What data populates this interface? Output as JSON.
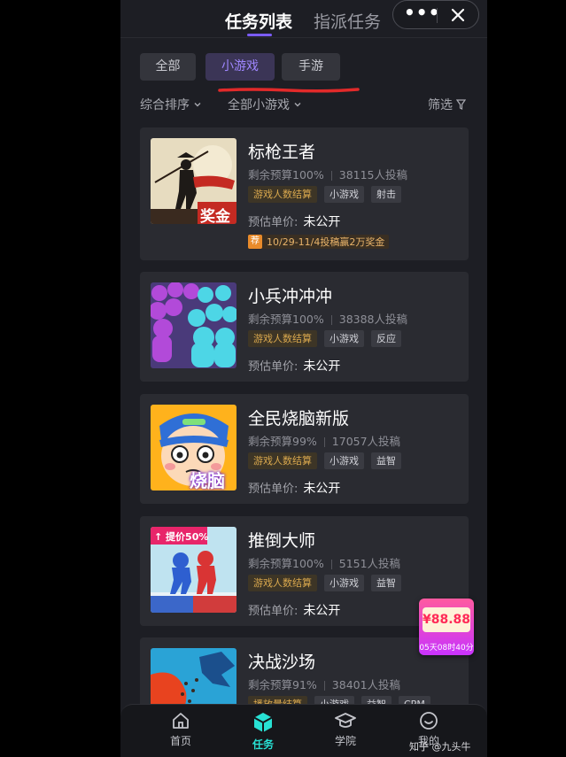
{
  "header": {
    "tab_active": "任务列表",
    "tab_inactive": "指派任务",
    "more_icon": "more-dots-icon",
    "close_icon": "close-icon"
  },
  "filters": {
    "chips": [
      "全部",
      "小游戏",
      "手游"
    ],
    "selected": "小游戏",
    "sort_label": "综合排序",
    "category_label": "全部小游戏",
    "filter_label": "筛选"
  },
  "tasks": [
    {
      "title": "标枪王者",
      "budget": "剩余预算100%",
      "submissions": "38115人投稿",
      "tags": [
        "游戏人数结算",
        "小游戏",
        "射击"
      ],
      "price_label": "预估单价:",
      "price_value": "未公开",
      "thumb_label": "奖金",
      "promo_badge": "荐",
      "promo_text": "10/29-11/4投稿赢2万奖金"
    },
    {
      "title": "小兵冲冲冲",
      "budget": "剩余预算100%",
      "submissions": "38388人投稿",
      "tags": [
        "游戏人数结算",
        "小游戏",
        "反应"
      ],
      "price_label": "预估单价:",
      "price_value": "未公开"
    },
    {
      "title": "全民烧脑新版",
      "budget": "剩余预算99%",
      "submissions": "17057人投稿",
      "tags": [
        "游戏人数结算",
        "小游戏",
        "益智"
      ],
      "price_label": "预估单价:",
      "price_value": "未公开",
      "thumb_label": "烧脑"
    },
    {
      "title": "推倒大师",
      "budget": "剩余预算100%",
      "submissions": "5151人投稿",
      "tags": [
        "游戏人数结算",
        "小游戏",
        "益智"
      ],
      "price_label": "预估单价:",
      "price_value": "未公开",
      "thumb_label": "提价50%"
    },
    {
      "title": "决战沙场",
      "budget": "剩余预算91%",
      "submissions": "38401人投稿",
      "tags": [
        "播放量结算",
        "小游戏",
        "益智",
        "CPM"
      ]
    }
  ],
  "red_packet": {
    "amount": "¥88.88",
    "countdown": "05天08时40分"
  },
  "bottom_nav": {
    "items": [
      "首页",
      "任务",
      "学院",
      "我的"
    ],
    "active": "任务"
  },
  "watermark": "知乎 @九头牛",
  "colors": {
    "accent_purple": "#7b5cff",
    "nav_active": "#28e1d4",
    "background": "#1d1e24",
    "card": "#2a2b31",
    "gold_tag": "#d9a84e"
  }
}
